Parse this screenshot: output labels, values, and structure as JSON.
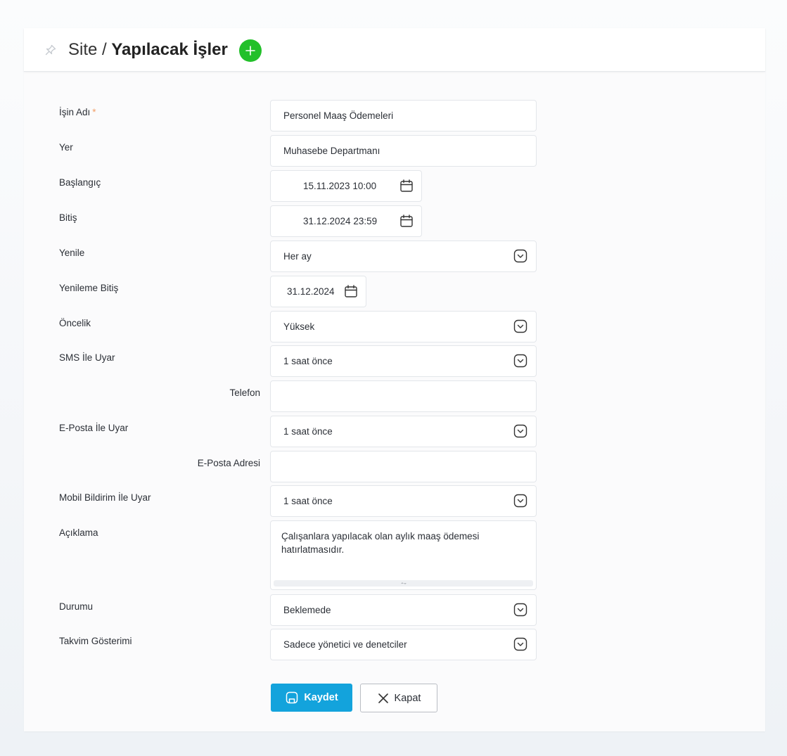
{
  "header": {
    "breadcrumb_root": "Site",
    "separator": "/",
    "title": "Yapılacak İşler",
    "icons": {
      "pin": "pin-icon",
      "add": "plus-circle-icon"
    },
    "add_color": "#22c02a"
  },
  "form": {
    "task_name": {
      "label": "İşin Adı",
      "required_mark": "*",
      "value": "Personel Maaş Ödemeleri"
    },
    "location": {
      "label": "Yer",
      "value": "Muhasebe Departmanı"
    },
    "start": {
      "label": "Başlangıç",
      "value": "15.11.2023 10:00"
    },
    "end": {
      "label": "Bitiş",
      "value": "31.12.2024 23:59"
    },
    "repeat": {
      "label": "Yenile",
      "value": "Her ay"
    },
    "repeat_end": {
      "label": "Yenileme Bitiş",
      "value": "31.12.2024"
    },
    "priority": {
      "label": "Öncelik",
      "value": "Yüksek"
    },
    "sms_alert": {
      "label": "SMS İle Uyar",
      "value": "1 saat önce"
    },
    "phone": {
      "label": "Telefon",
      "value": ""
    },
    "email_alert": {
      "label": "E-Posta İle Uyar",
      "value": "1 saat önce"
    },
    "email_address": {
      "label": "E-Posta Adresi",
      "value": ""
    },
    "mobile_alert": {
      "label": "Mobil Bildirim İle Uyar",
      "value": "1 saat önce"
    },
    "description": {
      "label": "Açıklama",
      "value": "Çalışanlara yapılacak olan aylık maaş ödemesi hatırlatmasıdır."
    },
    "status": {
      "label": "Durumu",
      "value": "Beklemede"
    },
    "calendar_display": {
      "label": "Takvim Gösterimi",
      "value": "Sadece yönetici ve denetciler"
    }
  },
  "actions": {
    "save_label": "Kaydet",
    "close_label": "Kapat",
    "save_color": "#13a3dc"
  }
}
